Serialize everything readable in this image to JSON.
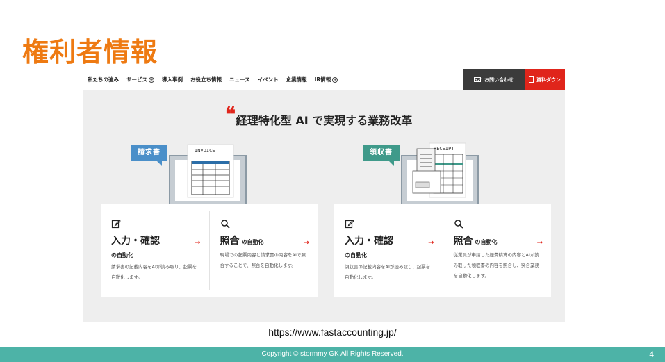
{
  "slide": {
    "title": "権利者情報",
    "url": "https://www.fastaccounting.jp/",
    "footer": "Copyright © stormmy GK All Rights Reserved.",
    "page_number": "4"
  },
  "website": {
    "nav": [
      {
        "label": "私たちの強み",
        "has_plus": false
      },
      {
        "label": "サービス",
        "has_plus": true
      },
      {
        "label": "導入事例",
        "has_plus": false
      },
      {
        "label": "お役立ち情報",
        "has_plus": false
      },
      {
        "label": "ニュース",
        "has_plus": false
      },
      {
        "label": "イベント",
        "has_plus": false
      },
      {
        "label": "企業情報",
        "has_plus": false
      },
      {
        "label": "IR情報",
        "has_plus": true
      }
    ],
    "contact_label": "お問い合わせ",
    "download_label": "資料ダウン",
    "hero_title": "経理特化型 AI で実現する業務改革",
    "quote_mark": "❝",
    "sections": [
      {
        "tag": "請求書",
        "doc_label": "INVOICE",
        "columns": [
          {
            "big": "入力・確認",
            "small": "",
            "sub": "の自動化",
            "desc": "請求書の記載内容をAIが読み取り、起票を自動化します。"
          },
          {
            "big": "照合",
            "small": "の自動化",
            "sub": "",
            "desc": "現場での起票内容と請求書の内容をAIで照合することで、照合を自動化します。"
          }
        ]
      },
      {
        "tag": "領収書",
        "doc_label": "RECEIPT",
        "columns": [
          {
            "big": "入力・確認",
            "small": "",
            "sub": "の自動化",
            "desc": "領収書の記載内容をAIが読み取り、起票を自動化します。"
          },
          {
            "big": "照合",
            "small": "の自動化",
            "sub": "",
            "desc": "従業員が申請した経費精算の内容とAIが読み取った領収書の内容を照合し、突合業務を自動化します。"
          }
        ]
      }
    ],
    "arrow": "→",
    "colors": {
      "accent_red": "#e0251b",
      "title_orange": "#ee7a12",
      "footer_teal": "#4db3a7",
      "tag_blue": "#4a8fc9",
      "tag_green": "#3f9a8a"
    }
  }
}
